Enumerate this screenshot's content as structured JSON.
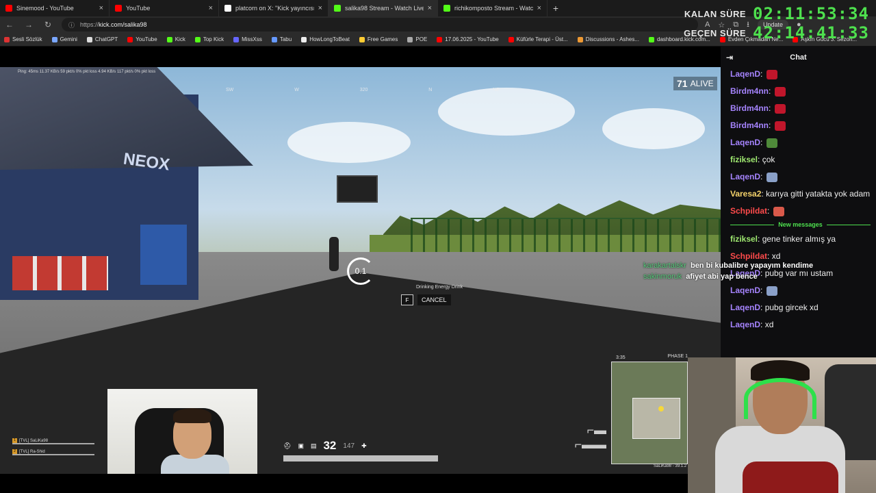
{
  "browser": {
    "tabs": [
      {
        "title": "Sinemood - YouTube",
        "icon": "youtube-icon",
        "color": "#ff0000"
      },
      {
        "title": "YouTube",
        "icon": "youtube-icon",
        "color": "#ff0000"
      },
      {
        "title": "platcorn on X: \"Kick yayıncısı sak",
        "icon": "x-icon",
        "color": "#ffffff"
      },
      {
        "title": "salika98 Stream - Watch Live on K",
        "icon": "kick-icon",
        "color": "#53fc18"
      },
      {
        "title": "richikomposto Stream - Watch Li",
        "icon": "kick-icon",
        "color": "#53fc18"
      }
    ],
    "url_prefix": "https://",
    "url_host": "kick.com/salika98",
    "update_label": "Update",
    "bookmarks": [
      {
        "label": "Sesli Sözlük",
        "color": "#d33"
      },
      {
        "label": "Gemini",
        "color": "#7aa7ff"
      },
      {
        "label": "ChatGPT",
        "color": "#ddd"
      },
      {
        "label": "YouTube",
        "color": "#f00"
      },
      {
        "label": "Kick",
        "color": "#53fc18"
      },
      {
        "label": "Top Kick",
        "color": "#53fc18"
      },
      {
        "label": "MissXss",
        "color": "#66f"
      },
      {
        "label": "Tabu",
        "color": "#69f"
      },
      {
        "label": "HowLongToBeat",
        "color": "#eee"
      },
      {
        "label": "Free Games",
        "color": "#fc3"
      },
      {
        "label": "POE",
        "color": "#aaa"
      },
      {
        "label": "17.06.2025 - YouTube",
        "color": "#f00"
      },
      {
        "label": "Küfürle Terapi - Üst...",
        "color": "#f00"
      },
      {
        "label": "Discussions - Ashes...",
        "color": "#e93"
      },
      {
        "label": "dashboard.kick.com...",
        "color": "#53fc18"
      },
      {
        "label": "Evden Çıkmadan Ne...",
        "color": "#f00"
      },
      {
        "label": "Aşkın Gücü 3. Sezon...",
        "color": "#f00"
      }
    ]
  },
  "overlay": {
    "remaining_label": "KALAN SÜRE",
    "remaining_time": "02:11:53:34",
    "elapsed_label": "GEÇEN SÜRE",
    "elapsed_time": "42:14:41:33"
  },
  "game": {
    "stats": "Ping: 45ms   11.37 KB/s  59 pkt/s   0% pkt loss   4.94 KB/s  117 pkt/s  0% pkt loss",
    "compass": [
      "SW",
      "W",
      "320",
      "N",
      "NE"
    ],
    "compass_value": "320",
    "alive_count": "71",
    "alive_label": "ALIVE",
    "timer": "0.1",
    "drinking": "Drinking Energy Drink",
    "cancel_key": "F",
    "cancel_label": "CANCEL",
    "sign_text": "NEOX",
    "killfeed": [
      {
        "user": "karakartalskr",
        "text": "ben bi kubalibre yapayım kendime"
      },
      {
        "user": "sakinmoruk",
        "text": "afiyet abi yap bence"
      }
    ],
    "team": [
      {
        "num": "1",
        "name": "[TVL] SaLiKa98"
      },
      {
        "num": "2",
        "name": "[TVL] Ra-Shid"
      }
    ],
    "ammo": "32",
    "ammo_reserve": "147",
    "zone_time": "3:35",
    "phase": "PHASE 1",
    "map_footer": "SaLiKa98 - 39.1.2"
  },
  "chat": {
    "title": "Chat",
    "new_messages_label": "New messages",
    "before": [
      {
        "user": "LaqenD",
        "text": "",
        "user_color": "#a684ff",
        "emote": "#c0162b"
      },
      {
        "user": "Birdm4nn",
        "text": "",
        "user_color": "#a684ff",
        "emote": "#c0162b"
      },
      {
        "user": "Birdm4nn",
        "text": "",
        "user_color": "#a684ff",
        "emote": "#c0162b"
      },
      {
        "user": "Birdm4nn",
        "text": "",
        "user_color": "#a684ff",
        "emote": "#c0162b"
      },
      {
        "user": "LaqenD",
        "text": "",
        "user_color": "#a684ff",
        "emote": "#4f8a3a"
      },
      {
        "user": "fiziksel",
        "text": "çok",
        "user_color": "#9fe870",
        "emote": ""
      },
      {
        "user": "LaqenD",
        "text": "",
        "user_color": "#a684ff",
        "emote": "#8aa0c8"
      },
      {
        "user": "Varesa2",
        "text": "karıya gitti yatakta yok adam",
        "user_color": "#f5d36b",
        "emote": ""
      },
      {
        "user": "Schpildat",
        "text": "",
        "user_color": "#ff4b4b",
        "emote": "#d9594a"
      }
    ],
    "after": [
      {
        "user": "fiziksel",
        "text": "gene tinker almış ya",
        "user_color": "#9fe870",
        "emote": ""
      },
      {
        "user": "Schpildat",
        "text": "xd",
        "user_color": "#ff4b4b",
        "emote": ""
      },
      {
        "user": "LaqenD",
        "text": "pubg var mı ustam",
        "user_color": "#a684ff",
        "emote": ""
      },
      {
        "user": "LaqenD",
        "text": "",
        "user_color": "#a684ff",
        "emote": "#8aa0c8"
      },
      {
        "user": "LaqenD",
        "text": "pubg gircek xd",
        "user_color": "#a684ff",
        "emote": ""
      },
      {
        "user": "LaqenD",
        "text": "xd",
        "user_color": "#a684ff",
        "emote": ""
      }
    ]
  }
}
